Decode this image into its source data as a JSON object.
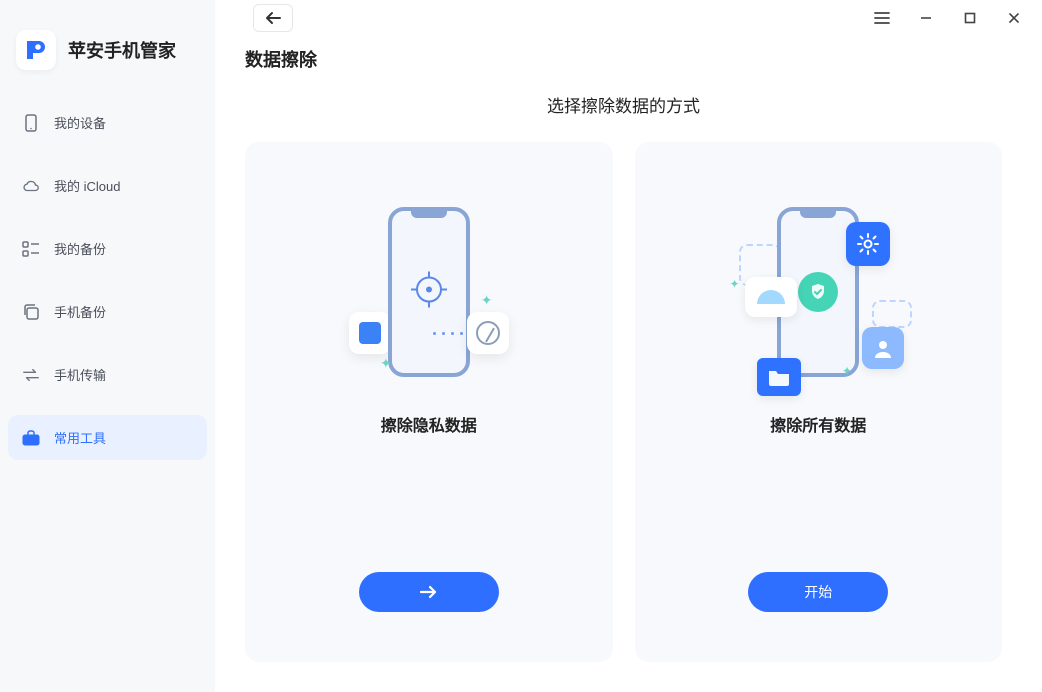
{
  "app_name": "苹安手机管家",
  "sidebar": {
    "items": [
      {
        "label": "我的设备"
      },
      {
        "label": "我的 iCloud"
      },
      {
        "label": "我的备份"
      },
      {
        "label": "手机备份"
      },
      {
        "label": "手机传输"
      },
      {
        "label": "常用工具"
      }
    ]
  },
  "page": {
    "title": "数据擦除",
    "subtitle": "选择擦除数据的方式"
  },
  "cards": {
    "privacy": {
      "title": "擦除隐私数据",
      "button": "→"
    },
    "erase_all": {
      "title": "擦除所有数据",
      "button": "开始"
    }
  }
}
